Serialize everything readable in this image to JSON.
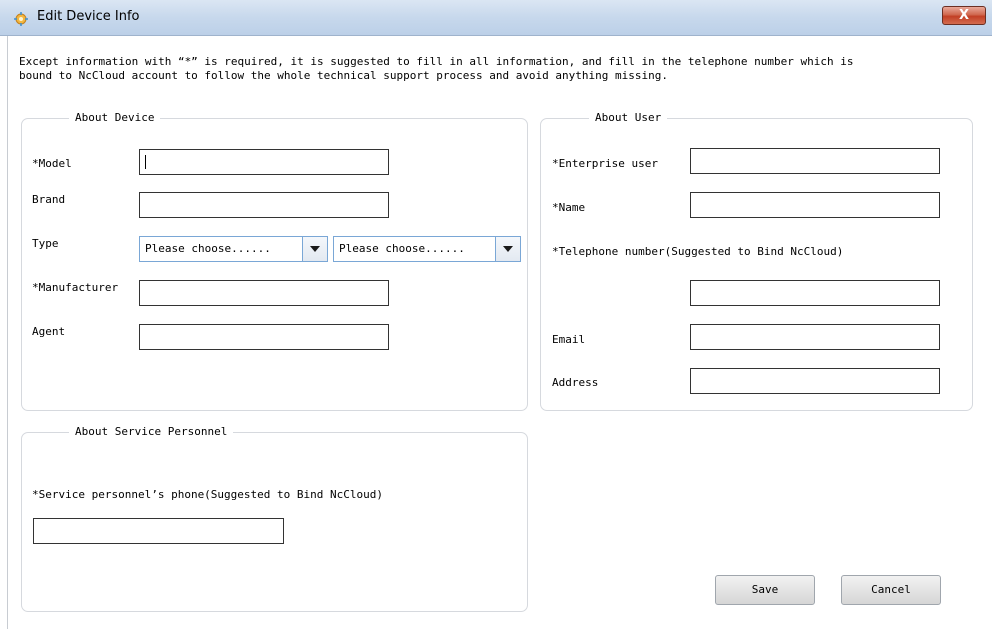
{
  "window": {
    "title": "Edit Device Info",
    "close_label": "X"
  },
  "notice": "Except information with “*” is required, it is suggested to fill in all information, and fill in the telephone number which is\nbound to NcCloud account to follow the whole technical support process and avoid anything missing.",
  "device": {
    "legend": "About Device",
    "model_label": "*Model",
    "model_value": "",
    "brand_label": "Brand",
    "brand_value": "",
    "type_label": "Type",
    "type_select_1": "Please choose......",
    "type_select_2": "Please choose......",
    "manufacturer_label": "*Manufacturer",
    "manufacturer_value": "",
    "agent_label": "Agent",
    "agent_value": ""
  },
  "user": {
    "legend": "About User",
    "enterprise_label": "*Enterprise user",
    "enterprise_value": "",
    "name_label": "*Name",
    "name_value": "",
    "phone_label": "*Telephone number(Suggested to Bind NcCloud)",
    "phone_value": "",
    "email_label": "Email",
    "email_value": "",
    "address_label": "Address",
    "address_value": ""
  },
  "service": {
    "legend": "About Service Personnel",
    "phone_label": "*Service personnel’s phone(Suggested to Bind NcCloud)",
    "phone_value": ""
  },
  "buttons": {
    "save": "Save",
    "cancel": "Cancel"
  },
  "icons": {
    "app": "settings-gear-icon",
    "close": "close-icon",
    "dropdown": "triangle-down-icon"
  }
}
